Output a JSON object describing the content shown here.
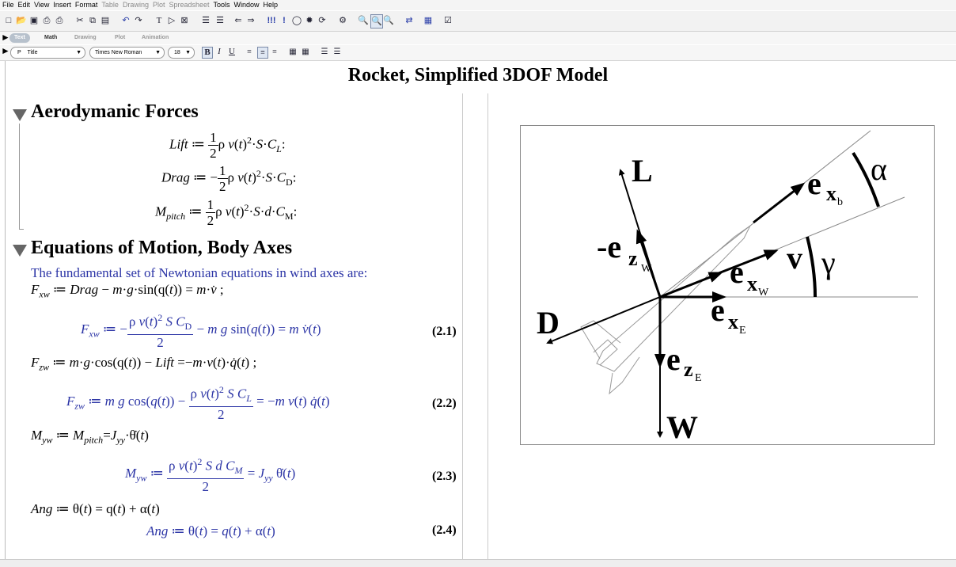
{
  "menu": {
    "items": [
      "File",
      "Edit",
      "View",
      "Insert",
      "Format"
    ],
    "disabled_items": [
      "Table",
      "Drawing",
      "Plot",
      "Spreadsheet"
    ],
    "items_after": [
      "Tools",
      "Window",
      "Help"
    ]
  },
  "toolbar": {
    "icons": [
      "new-icon",
      "open-icon",
      "save-icon",
      "print-icon",
      "print-preview-icon",
      "cut-icon",
      "copy-icon",
      "paste-icon",
      "undo-icon",
      "redo-icon",
      "text-icon",
      "math-icon",
      "execute-icon",
      "indent-icon",
      "back-icon",
      "forward-icon",
      "run-icon",
      "run-all-icon",
      "stop-icon",
      "debug-icon",
      "restart-icon",
      "settings-icon",
      "zoom-icon",
      "zoom-in-icon",
      "zoom-out-icon",
      "refresh-icon",
      "layout-icon",
      "help-icon"
    ]
  },
  "modes": {
    "text": "Text",
    "math": "Math",
    "drawing": "Drawing",
    "plot": "Plot",
    "animation": "Animation"
  },
  "format": {
    "style_icon": "P",
    "style": "Title",
    "font": "Times New Roman",
    "size": "18",
    "bold": "B",
    "italic": "I",
    "underline": "U"
  },
  "document": {
    "title": "Rocket, Simplified 3DOF Model",
    "section1": {
      "heading": "Aerodymanic Forces",
      "lift_lhs": "Lift",
      "drag_lhs": "Drag",
      "mpitch_lhs": "M",
      "mpitch_sub": "pitch"
    },
    "section2": {
      "heading": "Equations of Motion, Body Axes",
      "intro": "The fundamental set of Newtonian equations in wind axes are:",
      "eq_numbers": [
        "(2.1)",
        "(2.2)",
        "(2.3)",
        "(2.4)"
      ]
    }
  },
  "figure": {
    "labels": {
      "L": "L",
      "D": "D",
      "W": "W",
      "alpha": "α",
      "gamma": "γ",
      "v": "v",
      "neg_ez": "-e",
      "ex": "e",
      "ez": "e",
      "sub_x": "x",
      "sub_z": "z",
      "sub_b": "b",
      "sub_W": "W",
      "sub_E": "E"
    }
  }
}
